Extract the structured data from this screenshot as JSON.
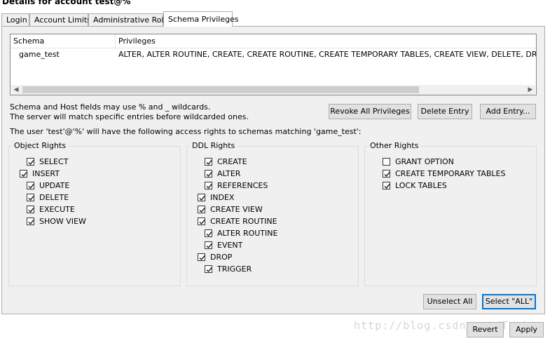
{
  "window": {
    "title": "Details for account test@%"
  },
  "tabs": [
    {
      "label": "Login",
      "active": false
    },
    {
      "label": "Account Limits",
      "active": false
    },
    {
      "label": "Administrative Roles",
      "active": false
    },
    {
      "label": "Schema Privileges",
      "active": true
    }
  ],
  "grid": {
    "headers": {
      "schema": "Schema",
      "privileges": "Privileges"
    },
    "rows": [
      {
        "schema": "game_test",
        "privileges": "ALTER, ALTER ROUTINE, CREATE, CREATE ROUTINE, CREATE TEMPORARY TABLES, CREATE VIEW, DELETE, DROP, E"
      }
    ]
  },
  "info": {
    "line1": "Schema and Host fields may use % and _ wildcards.",
    "line2": "The server will match specific entries before wildcarded ones.",
    "access_text": "The user 'test'@'%' will have the following access rights to schemas matching 'game_test':"
  },
  "buttons": {
    "revoke_all": "Revoke All Privileges",
    "delete_entry": "Delete Entry",
    "add_entry": "Add Entry...",
    "unselect_all": "Unselect All",
    "select_all": "Select \"ALL\"",
    "revert": "Revert",
    "apply": "Apply"
  },
  "object_rights": {
    "title": "Object Rights",
    "items": [
      {
        "label": "SELECT",
        "checked": true
      },
      {
        "label": "INSERT",
        "checked": true
      },
      {
        "label": "UPDATE",
        "checked": true
      },
      {
        "label": "DELETE",
        "checked": true
      },
      {
        "label": "EXECUTE",
        "checked": true
      },
      {
        "label": "SHOW VIEW",
        "checked": true
      }
    ]
  },
  "ddl_rights": {
    "title": "DDL Rights",
    "items": [
      {
        "label": "CREATE",
        "checked": true
      },
      {
        "label": "ALTER",
        "checked": true
      },
      {
        "label": "REFERENCES",
        "checked": true
      },
      {
        "label": "INDEX",
        "checked": true
      },
      {
        "label": "CREATE VIEW",
        "checked": true
      },
      {
        "label": "CREATE ROUTINE",
        "checked": true
      },
      {
        "label": "ALTER ROUTINE",
        "checked": true
      },
      {
        "label": "EVENT",
        "checked": true
      },
      {
        "label": "DROP",
        "checked": true
      },
      {
        "label": "TRIGGER",
        "checked": true
      }
    ]
  },
  "other_rights": {
    "title": "Other Rights",
    "items": [
      {
        "label": "GRANT OPTION",
        "checked": false
      },
      {
        "label": "CREATE TEMPORARY TABLES",
        "checked": true
      },
      {
        "label": "LOCK TABLES",
        "checked": true
      }
    ]
  },
  "watermark": "http://blog.csdn.net/Turkey"
}
